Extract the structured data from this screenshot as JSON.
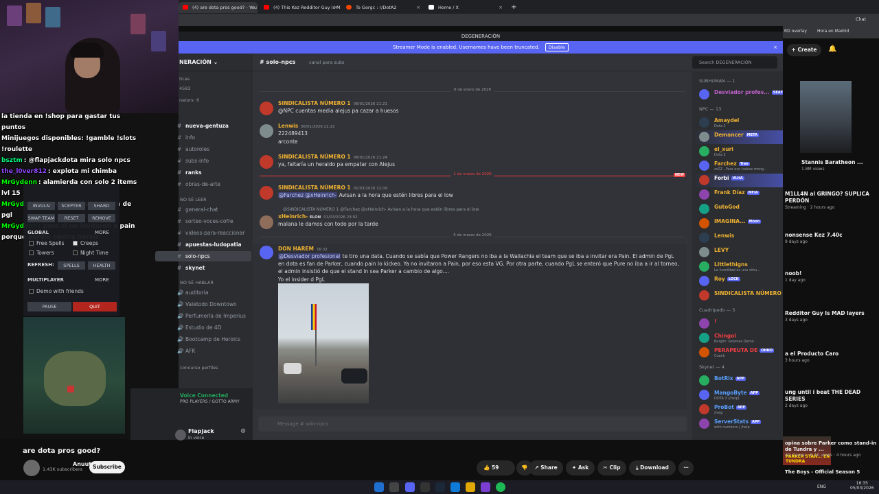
{
  "browser": {
    "tabs": [
      {
        "label": "(4) are dota pros good? - YouTube",
        "color": "#ff0000"
      },
      {
        "label": "(4) This Kez Redditor Guy Is MAD ...",
        "color": "#ff0000"
      },
      {
        "label": "To Gorgc : r/DotA2",
        "color": "#ff4500"
      },
      {
        "label": "Home / X",
        "color": "#ffffff"
      }
    ],
    "bookmarks": [
      "RD overlay",
      "Hora en Madrid"
    ],
    "chat_label": "Chat"
  },
  "stream_chat": [
    {
      "user": "",
      "text": "la tienda en !shop para gastar tus puntos",
      "color": "#ffffff"
    },
    {
      "user": "",
      "text": "Minijuegos disponibles: !gamble !slots !roulette",
      "color": "#ffffff"
    },
    {
      "user": "bsztm",
      "text": ": @flapjackdota mira solo npcs",
      "color": "#00ff7f"
    },
    {
      "user": "the_l0ver812",
      "text": ": explota mi chimba",
      "color": "#9146ff"
    },
    {
      "user": "MrGydenn",
      "text": ": alamierda con solo 2 items lvl 15",
      "color": "#00ff00"
    },
    {
      "user": "MrGydenn",
      "text": ": es no bianrie el admin de pgl",
      "color": "#00ff00"
    },
    {
      "user": "MrGydenn",
      "text": ": pero si no invitaron a pain porque perdio contra heroic",
      "color": "#00ff00"
    }
  ],
  "dota_panel": {
    "row1": [
      "INVULN",
      "SCEPTER",
      "SHARD"
    ],
    "row2": [
      "SWAP TEAM",
      "RESET",
      "REMOVE"
    ],
    "global_label": "GLOBAL",
    "more_label": "MORE",
    "options": [
      "Free Spells",
      "Creeps",
      "Towers",
      "Night Time"
    ],
    "refresh_label": "REFRESH:",
    "refresh_buttons": [
      "SPELLS",
      "HEALTH"
    ],
    "multiplayer_label": "MULTIPLAYER",
    "demo_friends": "Demo with friends",
    "pause": "PAUSE",
    "quit": "QUIT"
  },
  "yt_video": {
    "title": "are dota pros good?",
    "channel": "Anuutok",
    "subscribers": "1.43K subscribers",
    "subscribe": "Subscribe",
    "likes": "59",
    "share": "Share",
    "ask": "Ask",
    "clip": "Clip",
    "download": "Download"
  },
  "discord": {
    "window_title": "DEGENERACIÓN",
    "streamer_banner": "Streamer Mode is enabled. Usernames have been truncated.",
    "disable": "Disable",
    "guild_name": "NERACIÓN",
    "guild_stats": [
      "ticas",
      "4583",
      "nators: 6"
    ],
    "channels": [
      {
        "name": "nueva-gentuza",
        "bold": true
      },
      {
        "name": "info"
      },
      {
        "name": "autoroles"
      },
      {
        "name": "subs-info"
      },
      {
        "name": "ranks",
        "bold": true
      },
      {
        "name": "obras-de-arte"
      }
    ],
    "cat_no_se_leer": "NO SÉ LEER",
    "channels2": [
      {
        "name": "general-chat"
      },
      {
        "name": "sorteo-voces-cofre"
      },
      {
        "name": "videos-para-reaccionar"
      },
      {
        "name": "apuestas-ludopatia",
        "bold": true
      },
      {
        "name": "solo-npcs",
        "selected": true
      },
      {
        "name": "skynet",
        "bold": true
      }
    ],
    "cat_no_se_hablar": "NO SÉ HABLAR",
    "voice_channels": [
      "auditoria",
      "Valetodo Downtown",
      "Perfumería de Imperius",
      "Estudio de 4D",
      "Bootcamp de Heroics",
      "AFK"
    ],
    "concurso": "concurso perfiles",
    "voice_connected": "Voice Connected",
    "voice_server": "PRO PLAYERS / GOTTO ARMY",
    "username": "Flapjack",
    "user_status": "In voice",
    "channel_name": "solo-npcs",
    "channel_topic": "canal para subs",
    "search_placeholder": "Search DEGENERACIÓN",
    "composer_placeholder": "Message #  solo-npcs",
    "date1": "6 de enero de 2026",
    "date2": "1 de marzo de 2026",
    "date3": "5 de marzo de 2026",
    "new_label": "NEW",
    "messages": [
      {
        "name": "SINDICALISTA NÚMERO 1",
        "ts": "06/01/2026 21:21",
        "color": "#f0b232",
        "text": "@NPC cuentas media alejus pa cazar a huesos"
      },
      {
        "name": "Lenwis",
        "ts": "06/01/2026 21:22",
        "color": "#f0b232",
        "text": "222489413",
        "text2": "arconte"
      },
      {
        "name": "SINDICALISTA NÚMERO 1",
        "ts": "06/01/2026 21:24",
        "color": "#f0b232",
        "text": "ya, faltaría un heraldo pa empatar con Alejus"
      },
      {
        "name": "SINDICALISTA NÚMERO 1",
        "ts": "01/03/2026 12:09",
        "color": "#f0b232",
        "text": "Avisan a la hora que estén libres para el low",
        "mentions": "@Farchez @xHeinrich-"
      },
      {
        "reply": "@SINDICALISTA NÚMERO 1 @Farchez @xHeinrich- Avisan a la hora que estén libres para el low",
        "name": "xHeinrich-",
        "badge": "ELON",
        "ts": "01/03/2026 23:02",
        "color": "#f0b232",
        "text": "malana le damos con todo por la tarde"
      },
      {
        "name": "DON HAREM",
        "ts": "16:32",
        "color": "#f0b232",
        "mention": "@Desviador profesional",
        "text": " te tiro una data. Cuando se sabía que Power Rangers no iba a la Wallachia el team que se iba a invitar era Pain. El admin de PgL en dota es fan de Parker, cuando pain lo kickeo. Ya no invitaron a Pain, por eso esta VG. Por otra parte, cuando PgL se enteró que Pure no iba a ir al torneo, el admin insistió de que el stand in sea Parker a cambio de algo....",
        "text2": "Yo el insider d PgL"
      }
    ],
    "members_groups": [
      {
        "header": "SUBHUMAN — 1",
        "items": [
          {
            "name": "Desviador profes...",
            "tag": "SEAF",
            "color": "#c061cb"
          }
        ]
      },
      {
        "header": "NPC — 13",
        "items": [
          {
            "name": "Amaydel",
            "sub": "Dota 2",
            "color": "#f0b232"
          },
          {
            "name": "Demancer",
            "tag": "META",
            "color": "#f0b232"
          },
          {
            "name": "el_xuri",
            "sub": "Dota 2",
            "color": "#f0b232"
          },
          {
            "name": "Farchez",
            "tag": "Tree",
            "sub": "zzZZ...Para eso hablas mong...",
            "color": "#f0b232"
          },
          {
            "name": "Forbi",
            "tag": "VLHA",
            "color": "#ffffff"
          },
          {
            "name": "Frank Díaz",
            "tag": "MFIA",
            "color": "#f0b232"
          },
          {
            "name": "GutoGod",
            "color": "#f0b232"
          },
          {
            "name": "IMAGINA...",
            "tag": "Moon",
            "color": "#f0b232"
          },
          {
            "name": "Lenwis",
            "color": "#f0b232"
          },
          {
            "name": "LEVY",
            "color": "#f0b232"
          },
          {
            "name": "Littlethigns",
            "sub": "La humildad es una virtu...",
            "color": "#f0b232"
          },
          {
            "name": "Roy",
            "tag": "LOCK",
            "color": "#f0b232"
          },
          {
            "name": "SINDICALISTA NÚMERO 1",
            "color": "#f0b232"
          }
        ]
      },
      {
        "header": "Cuadrípedo — 3",
        "items": [
          {
            "name": "!",
            "color": "#f23f43"
          },
          {
            "name": "Chingol",
            "sub": "Borglin' Gnomes Demo",
            "color": "#f23f43"
          },
          {
            "name": "PERAPEUTA DE",
            "tag": "OHNO",
            "sub": "Cuack",
            "color": "#f23f43"
          }
        ]
      },
      {
        "header": "Skynet — 4",
        "items": [
          {
            "name": "BotRix",
            "tag": "APP",
            "color": "#5aa0ff"
          },
          {
            "name": "MangoByte",
            "tag": "APP",
            "sub": "DOTA 3 (/help)",
            "color": "#5aa0ff"
          },
          {
            "name": "ProBot",
            "tag": "APP",
            "sub": "/help",
            "color": "#5aa0ff"
          },
          {
            "name": "ServerStats",
            "tag": "APP",
            "sub": "with numbers | /help",
            "color": "#5aa0ff"
          }
        ]
      }
    ]
  },
  "yt_sidebar": {
    "create": "Create",
    "notif_count": "2",
    "videos": [
      {
        "title": "Stannis Baratheon ...",
        "meta": "1.8M views"
      },
      {
        "title": "M1LL4N al GRINGO? SUPLICA PERDÓN",
        "meta": "Streaming · 2 hours ago"
      },
      {
        "title": "nonsense Kez 7.40c",
        "meta": "9 days ago"
      },
      {
        "title": "noob!",
        "meta": "1 day ago"
      },
      {
        "title": "Redditor Guy Is MAD layers",
        "meta": "3 days ago"
      },
      {
        "title": "a el Producto Caro",
        "meta": "3 hours ago"
      },
      {
        "title": "ung until i beat THE DEAD SERIES",
        "meta": "2 days ago"
      },
      {
        "title": "opina sobre Parker como stand-in de Tundra y ...",
        "meta": "AD Gamer · 8.1K views · 4 hours ago"
      },
      {
        "title": "The Boys - Official Season 5",
        "meta": ""
      }
    ],
    "thumb_text": "PARKER STAN... EN TUNDRA",
    "badge_new": "New"
  },
  "taskbar": {
    "lang": "ENG",
    "time": "16:35",
    "date": "05/03/2026"
  }
}
